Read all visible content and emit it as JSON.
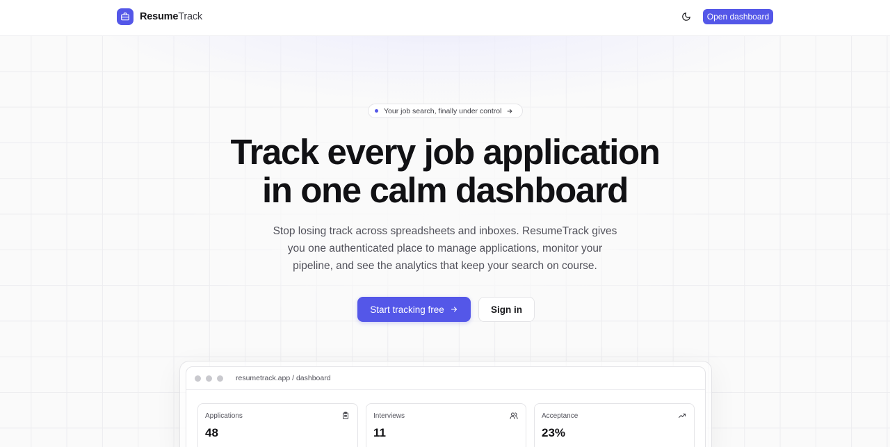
{
  "header": {
    "brand_bold": "Resume",
    "brand_light": "Track",
    "open_dashboard": "Open dashboard"
  },
  "hero": {
    "pill_text": "Your job search, finally under control",
    "headline_line1": "Track every job application",
    "headline_line2": "in one calm dashboard",
    "subtitle": "Stop losing track across spreadsheets and inboxes. ResumeTrack gives you one authenticated place to manage applications, monitor your pipeline, and see the analytics that keep your search on course.",
    "cta_primary": "Start tracking free",
    "cta_secondary": "Sign in"
  },
  "preview": {
    "url": "resumetrack.app / dashboard",
    "stats": [
      {
        "label": "Applications",
        "value": "48",
        "icon": "clipboard-icon"
      },
      {
        "label": "Interviews",
        "value": "11",
        "icon": "users-icon"
      },
      {
        "label": "Acceptance",
        "value": "23%",
        "icon": "trending-up-icon"
      }
    ]
  },
  "colors": {
    "accent": "#5457e8",
    "text": "#18181b",
    "muted": "#52525b",
    "border": "#e4e4e7"
  }
}
